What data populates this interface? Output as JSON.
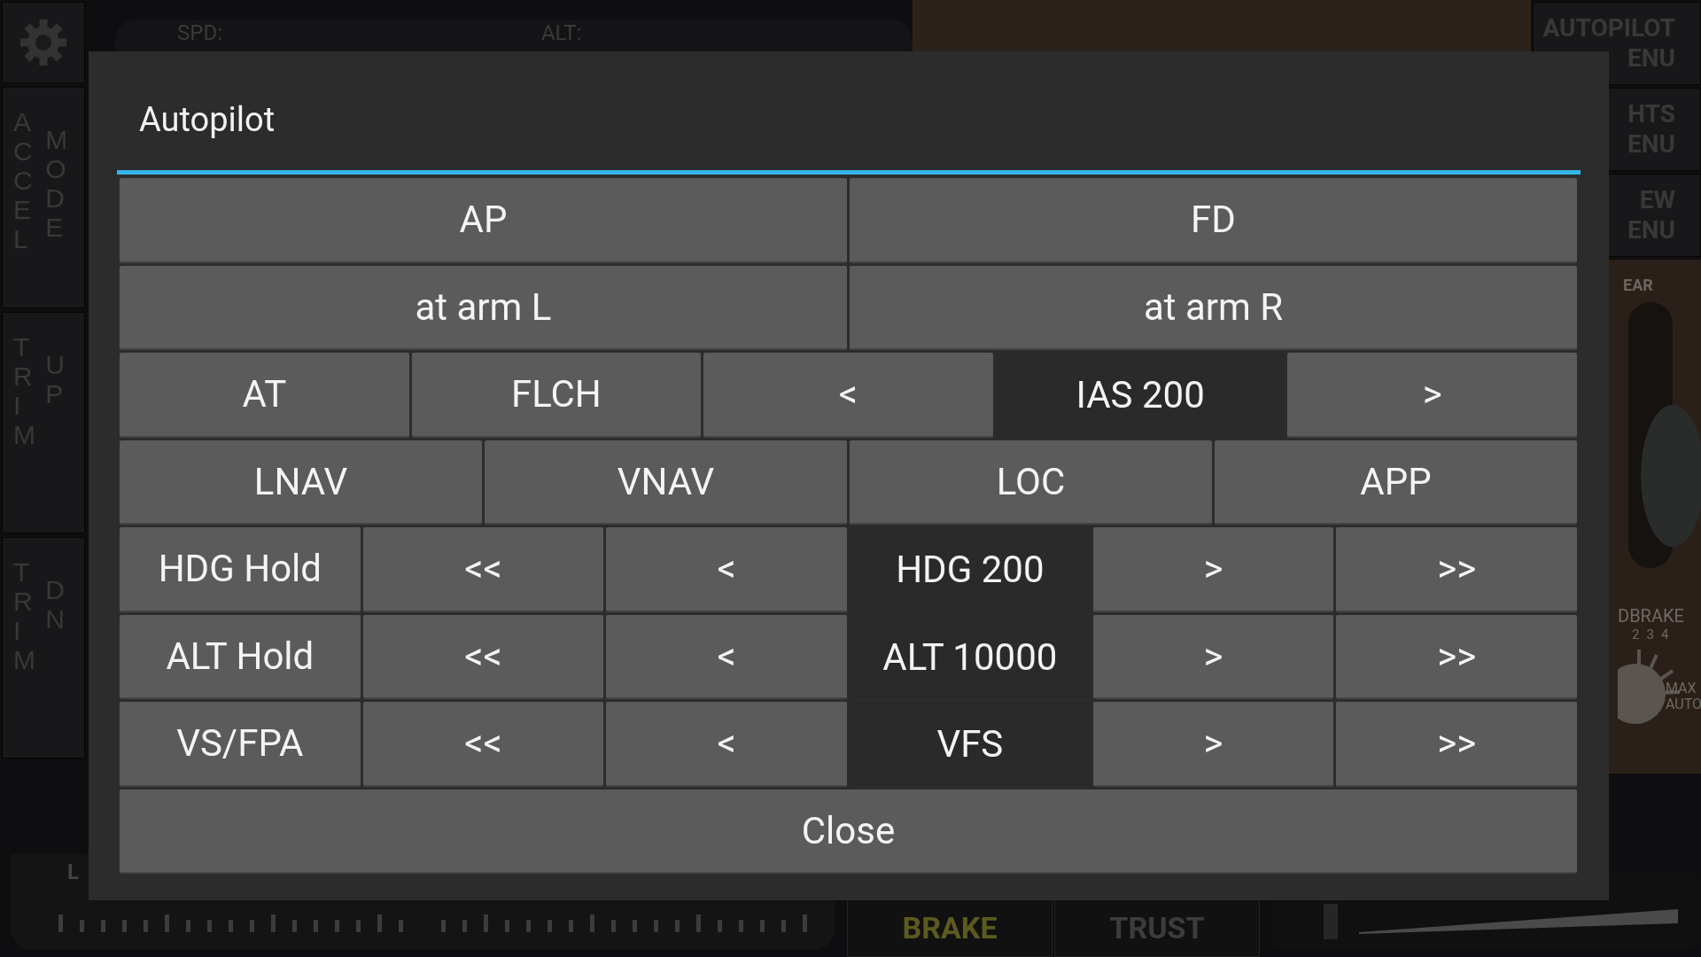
{
  "background": {
    "top_bar": {
      "speed_label": "SPD:",
      "altitude_label": "ALT:"
    },
    "left_buttons": [
      {
        "columns": [
          "ACCEL",
          "MODE"
        ]
      },
      {
        "columns": [
          "TRIM",
          "UP"
        ]
      },
      {
        "columns": [
          "TRIM",
          "DN"
        ]
      }
    ],
    "right_menus": [
      {
        "lines": [
          "AUTOPILOT",
          "ENU"
        ]
      },
      {
        "lines": [
          "HTS",
          "ENU"
        ]
      },
      {
        "lines": [
          "EW",
          "ENU"
        ]
      }
    ],
    "gear_label": "EAR",
    "speedbrake": {
      "label": "DBRAKE",
      "detents": [
        "2",
        "3",
        "4"
      ],
      "max_label": "MAX",
      "auto_label": "AUTO"
    },
    "throttle_label": "L",
    "bottom_buttons": [
      {
        "label": "BRAKE",
        "on": true
      },
      {
        "label": "TRUST",
        "on": false
      }
    ]
  },
  "dialog": {
    "title": "Autopilot",
    "rows": [
      [
        {
          "label": "AP",
          "kind": "button"
        },
        {
          "label": "FD",
          "kind": "button"
        }
      ],
      [
        {
          "label": "at arm L",
          "kind": "button"
        },
        {
          "label": "at arm R",
          "kind": "button"
        }
      ],
      [
        {
          "label": "AT",
          "kind": "button"
        },
        {
          "label": "FLCH",
          "kind": "button"
        },
        {
          "label": "<",
          "kind": "button"
        },
        {
          "label": "IAS 200",
          "kind": "display"
        },
        {
          "label": ">",
          "kind": "button"
        }
      ],
      [
        {
          "label": "LNAV",
          "kind": "button"
        },
        {
          "label": "VNAV",
          "kind": "button"
        },
        {
          "label": "LOC",
          "kind": "button"
        },
        {
          "label": "APP",
          "kind": "button"
        }
      ],
      [
        {
          "label": "HDG Hold",
          "kind": "button"
        },
        {
          "label": "<<",
          "kind": "button"
        },
        {
          "label": "<",
          "kind": "button"
        },
        {
          "label": "HDG 200",
          "kind": "display"
        },
        {
          "label": ">",
          "kind": "button"
        },
        {
          "label": ">>",
          "kind": "button"
        }
      ],
      [
        {
          "label": "ALT Hold",
          "kind": "button"
        },
        {
          "label": "<<",
          "kind": "button"
        },
        {
          "label": "<",
          "kind": "button"
        },
        {
          "label": "ALT 10000",
          "kind": "display"
        },
        {
          "label": ">",
          "kind": "button"
        },
        {
          "label": ">>",
          "kind": "button"
        }
      ],
      [
        {
          "label": "VS/FPA",
          "kind": "button"
        },
        {
          "label": "<<",
          "kind": "button"
        },
        {
          "label": "<",
          "kind": "button"
        },
        {
          "label": "VFS",
          "kind": "display"
        },
        {
          "label": ">",
          "kind": "button"
        },
        {
          "label": ">>",
          "kind": "button"
        }
      ]
    ],
    "close": "Close"
  }
}
